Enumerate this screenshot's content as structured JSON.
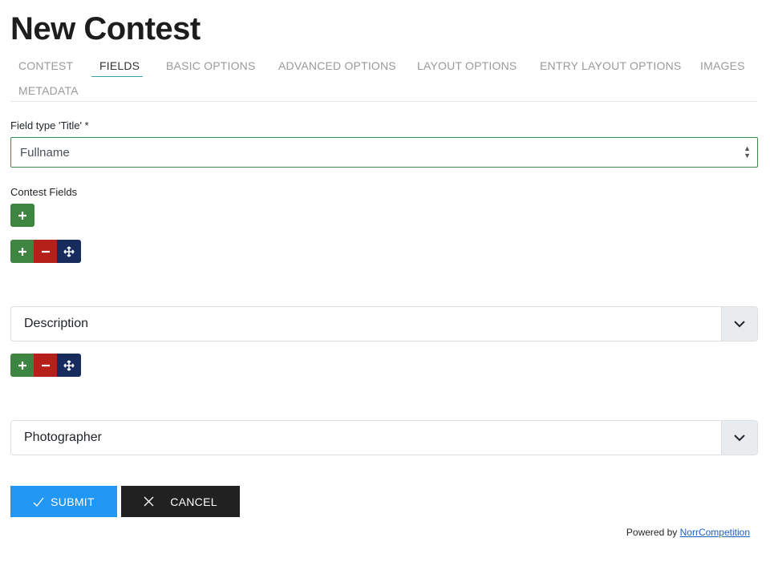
{
  "page": {
    "title": "New Contest"
  },
  "tabs": [
    {
      "label": "CONTEST",
      "active": false
    },
    {
      "label": "FIELDS",
      "active": true
    },
    {
      "label": "BASIC OPTIONS",
      "active": false
    },
    {
      "label": "ADVANCED OPTIONS",
      "active": false
    },
    {
      "label": "LAYOUT OPTIONS",
      "active": false
    },
    {
      "label": "ENTRY LAYOUT OPTIONS",
      "active": false
    },
    {
      "label": "IMAGES",
      "active": false
    },
    {
      "label": "METADATA",
      "active": false
    }
  ],
  "title_field": {
    "label": "Field type 'Title' *",
    "value": "Fullname"
  },
  "contest_fields": {
    "label": "Contest Fields",
    "items": [
      {
        "label": "Description"
      },
      {
        "label": "Photographer"
      }
    ]
  },
  "icons": {
    "add": "plus-icon",
    "remove": "minus-icon",
    "move": "move-icon",
    "expand": "chevron-down-icon",
    "submit": "check-icon",
    "cancel": "close-icon"
  },
  "actions": {
    "submit_label": "SUBMIT",
    "cancel_label": "CANCEL"
  },
  "footer": {
    "powered_text": "Powered by",
    "link_text": "NorrCompetition"
  },
  "colors": {
    "add": "#3e8541",
    "remove": "#b5211a",
    "move": "#172c5c",
    "submit": "#2196f3",
    "cancel": "#212121",
    "active_tab_underline": "#3aa0a8",
    "select_border": "#3d8a4a"
  }
}
